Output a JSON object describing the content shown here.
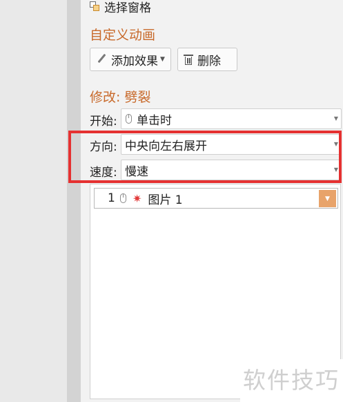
{
  "selection_pane": {
    "label": "选择窗格",
    "icon": "selection-pane-icon"
  },
  "custom_animation": {
    "title": "自定义动画",
    "add_effect_label": "添加效果",
    "delete_label": "删除"
  },
  "modify": {
    "title": "修改: 劈裂",
    "start": {
      "label": "开始:",
      "value": "单击时"
    },
    "direction": {
      "label": "方向:",
      "value": "中央向左右展开"
    },
    "speed": {
      "label": "速度:",
      "value": "慢速"
    }
  },
  "animation_list": {
    "items": [
      {
        "index": "1",
        "name": "图片 1",
        "trigger_icon": "mouse-click-icon",
        "effect_icon": "entrance-effect-star-icon"
      }
    ]
  },
  "colors": {
    "accent": "#c8692a",
    "highlight": "#e53131",
    "dropdown_button": "#e8a36a"
  },
  "watermark": "软件技巧"
}
